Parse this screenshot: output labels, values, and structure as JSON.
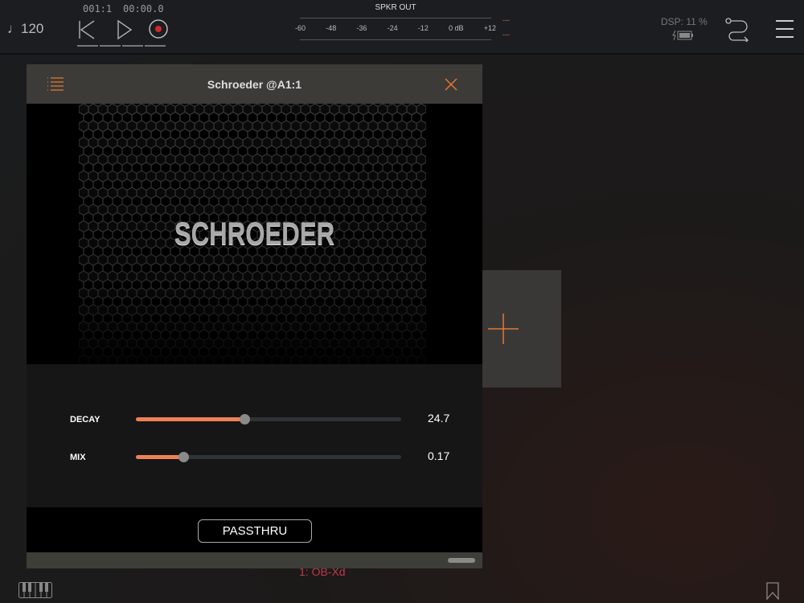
{
  "transport": {
    "tempo": "120",
    "position": "001:1",
    "time": "00:00.0"
  },
  "meter": {
    "title": "SPKR OUT",
    "scale": [
      "-60",
      "-48",
      "-36",
      "-24",
      "-12",
      "0 dB",
      "+12"
    ],
    "peak_l": "---",
    "peak_r": "---"
  },
  "status": {
    "dsp": "DSP: 11 %"
  },
  "plugin": {
    "title": "Schroeder @A1:1",
    "logo": "SCHROEDER",
    "params": [
      {
        "label": "DECAY",
        "value": "24.7",
        "fraction": 0.41
      },
      {
        "label": "MIX",
        "value": "0.17",
        "fraction": 0.18
      }
    ],
    "passthru": "PASSTHRU"
  },
  "track_label": "1: OB-Xd",
  "colors": {
    "accent": "#ee8055",
    "record": "#d0282a",
    "track_label": "#c0384a"
  }
}
